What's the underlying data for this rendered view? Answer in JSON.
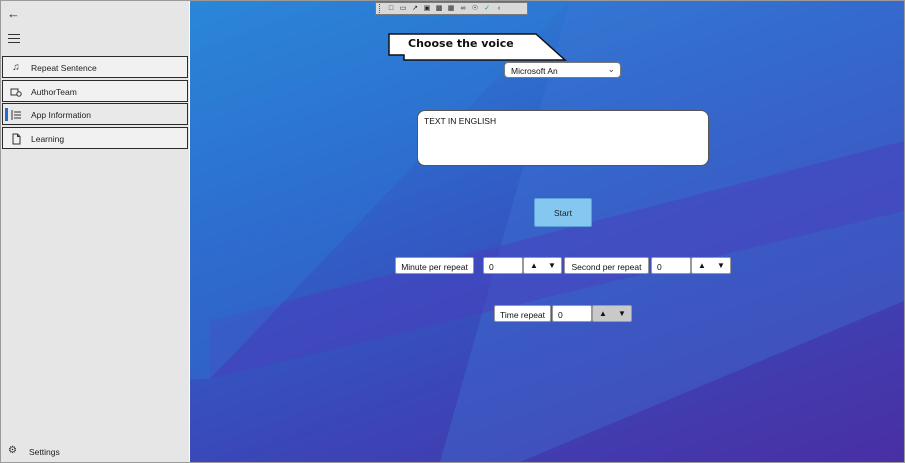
{
  "sidebar": {
    "back_icon": "arrow-left-icon",
    "menu_icon": "hamburger-icon",
    "items": [
      {
        "label": "Repeat Sentence",
        "icon": "music-note-icon"
      },
      {
        "label": "AuthorTeam",
        "icon": "people-icon"
      },
      {
        "label": "App Information",
        "icon": "list-icon"
      },
      {
        "label": "Learning",
        "icon": "document-icon"
      }
    ],
    "selected_index": 2,
    "settings_label": "Settings",
    "settings_icon": "gear-icon"
  },
  "main": {
    "callout_text": "Choose the voice",
    "voice_selected": "Microsoft An",
    "text_input_value": "TEXT IN ENGLISH",
    "start_label": "Start",
    "minute_label": "Minute per repeat",
    "minute_value": "0",
    "second_label": "Second per repeat",
    "second_value": "0",
    "time_repeat_label": "Time repeat",
    "time_repeat_value": "0",
    "up_glyph": "▲",
    "down_glyph": "▼"
  },
  "colors": {
    "accent": "#1f6fc4",
    "start_button": "#86c7f2",
    "bg_top": "#2a8bd9",
    "bg_bottom": "#4a2ea4"
  }
}
